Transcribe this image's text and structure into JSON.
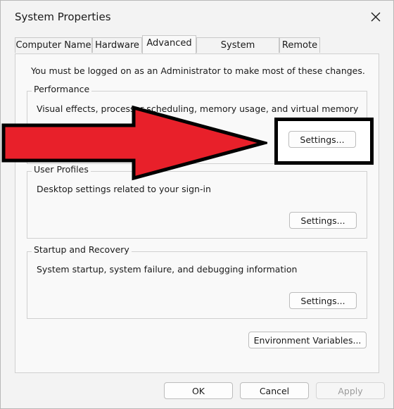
{
  "window": {
    "title": "System Properties"
  },
  "tabs": [
    {
      "label": "Computer Name",
      "active": false
    },
    {
      "label": "Hardware",
      "active": false
    },
    {
      "label": "Advanced",
      "active": true
    },
    {
      "label": "System Protection",
      "active": false
    },
    {
      "label": "Remote",
      "active": false
    }
  ],
  "admin_note": "You must be logged on as an Administrator to make most of these changes.",
  "performance": {
    "label": "Performance",
    "description": "Visual effects, processor scheduling, memory usage, and virtual memory",
    "button": "Settings..."
  },
  "user_profiles": {
    "label": "User Profiles",
    "description": "Desktop settings related to your sign-in",
    "button": "Settings..."
  },
  "startup_recovery": {
    "label": "Startup and Recovery",
    "description": "System startup, system failure, and debugging information",
    "button": "Settings..."
  },
  "env_button": "Environment Variables...",
  "footer": {
    "ok": "OK",
    "cancel": "Cancel",
    "apply": "Apply"
  },
  "colors": {
    "arrow": "#e8202a",
    "highlight_border": "#000000"
  }
}
